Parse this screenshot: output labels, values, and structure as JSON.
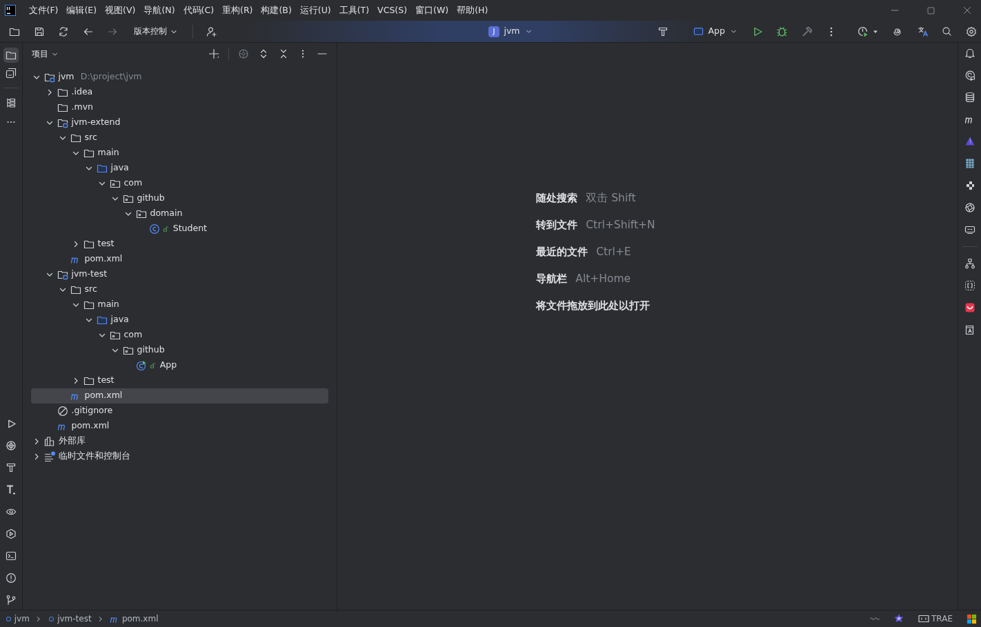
{
  "menu": [
    "文件(F)",
    "编辑(E)",
    "视图(V)",
    "导航(N)",
    "代码(C)",
    "重构(R)",
    "构建(B)",
    "运行(U)",
    "工具(T)",
    "VCS(S)",
    "窗口(W)",
    "帮助(H)"
  ],
  "toolbar": {
    "vcs": "版本控制",
    "project_badge": "J",
    "project": "jvm",
    "run_config": "App"
  },
  "panel": {
    "title": "项目"
  },
  "tree": [
    {
      "kind": "module",
      "label": "jvm",
      "hint": "D:\\project\\jvm",
      "expanded": true,
      "selected": false,
      "children": [
        {
          "kind": "folder",
          "label": ".idea",
          "expanded": false,
          "selected": false
        },
        {
          "kind": "folder",
          "label": ".mvn",
          "selected": false
        },
        {
          "kind": "module",
          "label": "jvm-extend",
          "expanded": true,
          "selected": false,
          "children": [
            {
              "kind": "folder",
              "label": "src",
              "expanded": true,
              "selected": false,
              "children": [
                {
                  "kind": "folder",
                  "label": "main",
                  "expanded": true,
                  "selected": false,
                  "children": [
                    {
                      "kind": "source",
                      "label": "java",
                      "expanded": true,
                      "selected": false,
                      "children": [
                        {
                          "kind": "package",
                          "label": "com",
                          "expanded": true,
                          "selected": false,
                          "children": [
                            {
                              "kind": "package",
                              "label": "github",
                              "expanded": true,
                              "selected": false,
                              "children": [
                                {
                                  "kind": "package",
                                  "label": "domain",
                                  "expanded": true,
                                  "selected": false,
                                  "children": [
                                    {
                                      "kind": "class",
                                      "label": "Student",
                                      "selected": false
                                    }
                                  ]
                                }
                              ]
                            }
                          ]
                        }
                      ]
                    }
                  ]
                },
                {
                  "kind": "folder",
                  "label": "test",
                  "expanded": false,
                  "selected": false
                }
              ]
            },
            {
              "kind": "maven",
              "label": "pom.xml",
              "selected": false
            }
          ]
        },
        {
          "kind": "module",
          "label": "jvm-test",
          "expanded": true,
          "selected": false,
          "children": [
            {
              "kind": "folder",
              "label": "src",
              "expanded": true,
              "selected": false,
              "children": [
                {
                  "kind": "folder",
                  "label": "main",
                  "expanded": true,
                  "selected": false,
                  "children": [
                    {
                      "kind": "source",
                      "label": "java",
                      "expanded": true,
                      "selected": false,
                      "children": [
                        {
                          "kind": "package",
                          "label": "com",
                          "expanded": true,
                          "selected": false,
                          "children": [
                            {
                              "kind": "package",
                              "label": "github",
                              "expanded": true,
                              "selected": false,
                              "children": [
                                {
                                  "kind": "main_class",
                                  "label": "App",
                                  "selected": false
                                }
                              ]
                            }
                          ]
                        }
                      ]
                    }
                  ]
                },
                {
                  "kind": "folder",
                  "label": "test",
                  "expanded": false,
                  "selected": false
                }
              ]
            },
            {
              "kind": "maven",
              "label": "pom.xml",
              "selected": true
            }
          ]
        },
        {
          "kind": "ignore",
          "label": ".gitignore",
          "selected": false
        },
        {
          "kind": "maven",
          "label": "pom.xml",
          "selected": false
        }
      ]
    },
    {
      "kind": "library",
      "label": "外部库",
      "expanded": false,
      "selected": false
    },
    {
      "kind": "scratch",
      "label": "临时文件和控制台",
      "expanded": false,
      "selected": false
    }
  ],
  "editor_hints": [
    {
      "action": "随处搜索",
      "shortcut": "双击 Shift"
    },
    {
      "action": "转到文件",
      "shortcut": "Ctrl+Shift+N"
    },
    {
      "action": "最近的文件",
      "shortcut": "Ctrl+E"
    },
    {
      "action": "导航栏",
      "shortcut": "Alt+Home"
    },
    {
      "action": "将文件拖放到此处以打开"
    }
  ],
  "breadcrumbs": [
    {
      "kind": "module",
      "label": "jvm"
    },
    {
      "kind": "module",
      "label": "jvm-test"
    },
    {
      "kind": "maven",
      "label": "pom.xml"
    }
  ],
  "status_bar": {
    "plugin": "TRAE"
  }
}
